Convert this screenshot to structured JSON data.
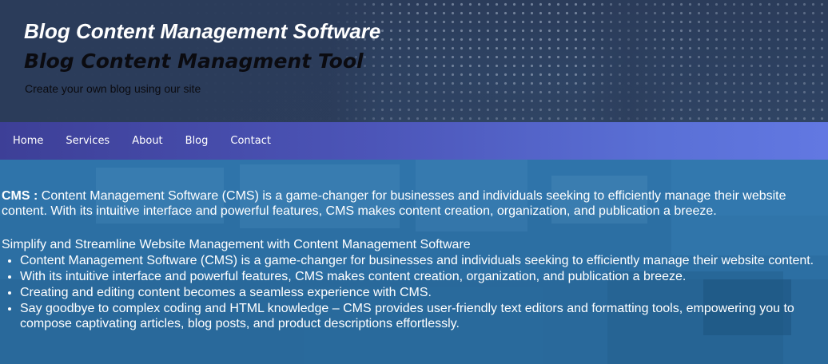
{
  "header": {
    "title": "Blog Content Management Software",
    "subtitle": "Blog Content Managment Tool",
    "tagline": "Create your own blog using our site"
  },
  "nav": {
    "items": [
      {
        "label": "Home"
      },
      {
        "label": "Services"
      },
      {
        "label": "About"
      },
      {
        "label": "Blog"
      },
      {
        "label": "Contact"
      }
    ]
  },
  "main": {
    "intro_bold": "CMS :",
    "intro_text": " Content Management Software (CMS) is a game-changer for businesses and individuals seeking to efficiently manage their website content. With its intuitive interface and powerful features, CMS makes content creation, organization, and publication a breeze.",
    "section_heading": "Simplify and Streamline Website Management with Content Management Software",
    "points": [
      "Content Management Software (CMS) is a game-changer for businesses and individuals seeking to efficiently manage their website content.",
      "With its intuitive interface and powerful features, CMS makes content creation, organization, and publication a breeze.",
      "Creating and editing content becomes a seamless experience with CMS.",
      "Say goodbye to complex coding and HTML knowledge – CMS provides user-friendly text editors and formatting tools, empowering you to compose captivating articles, blog posts, and product descriptions effortlessly."
    ]
  },
  "colors": {
    "header_bg": "#2f4566",
    "nav_start": "#3d3f97",
    "nav_end": "#6278e2",
    "main_bg": "#2c6fa3",
    "text_light": "#ffffff",
    "text_dark": "#0b0b10"
  }
}
